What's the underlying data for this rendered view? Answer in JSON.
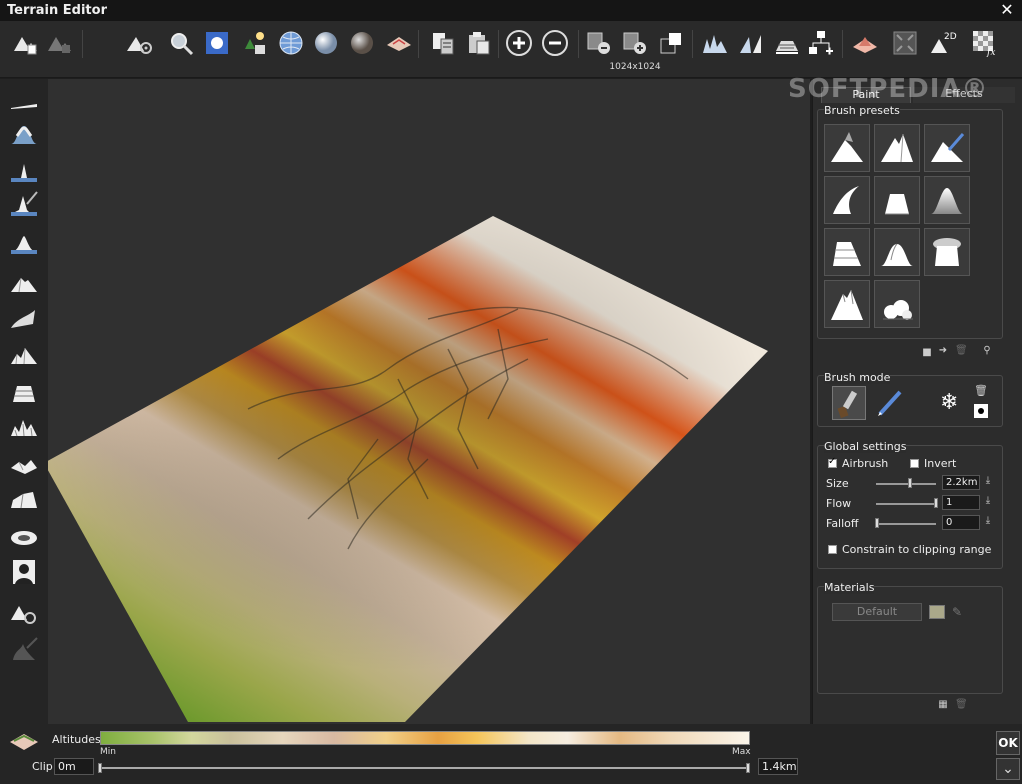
{
  "window": {
    "title": "Terrain Editor",
    "close_label": "✕"
  },
  "toolbar": {
    "resolution_label": "1024x1024"
  },
  "watermark": "SOFTPEDIA®",
  "panel": {
    "tabs": [
      {
        "label": "Paint"
      },
      {
        "label": "Effects"
      }
    ],
    "brush_presets_label": "Brush presets",
    "brush_mode_label": "Brush mode",
    "global_settings_label": "Global settings",
    "airbrush_label": "Airbrush",
    "invert_label": "Invert",
    "size_label": "Size",
    "size_value": "2.2km",
    "flow_label": "Flow",
    "flow_value": "1",
    "falloff_label": "Falloff",
    "falloff_value": "0",
    "constrain_label": "Constrain to clipping range",
    "materials_label": "Materials",
    "material_button": "Default"
  },
  "bottom": {
    "altitudes_label": "Altitudes",
    "min_label": "Min",
    "max_label": "Max",
    "clip_label": "Clip",
    "clip_min": "0m",
    "clip_max": "1.4km",
    "ok_label": "OK"
  }
}
